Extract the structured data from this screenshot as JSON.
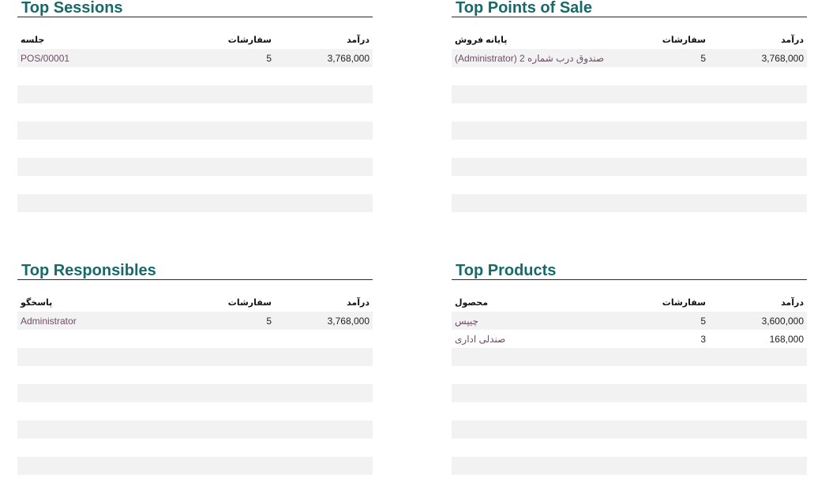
{
  "sessions": {
    "title": "Top Sessions",
    "headers": [
      "جلسه",
      "سفارشات",
      "درآمد"
    ],
    "rows": [
      {
        "name": "POS/00001",
        "orders": "5",
        "revenue": "3,768,000"
      }
    ]
  },
  "points_of_sale": {
    "title": "Top Points of Sale",
    "headers": [
      "پایانه فروش",
      "سفارشات",
      "درآمد"
    ],
    "rows": [
      {
        "name": "صندوق درب شماره 2 (Administrator)",
        "orders": "5",
        "revenue": "3,768,000"
      }
    ]
  },
  "responsibles": {
    "title": "Top Responsibles",
    "headers": [
      "پاسخگو",
      "سفارشات",
      "درآمد"
    ],
    "rows": [
      {
        "name": "Administrator",
        "orders": "5",
        "revenue": "3,768,000"
      }
    ]
  },
  "products": {
    "title": "Top Products",
    "headers": [
      "محصول",
      "سفارشات",
      "درآمد"
    ],
    "rows": [
      {
        "name": "چیپس",
        "orders": "5",
        "revenue": "3,600,000"
      },
      {
        "name": "صندلی اداری",
        "orders": "3",
        "revenue": "168,000"
      }
    ]
  }
}
